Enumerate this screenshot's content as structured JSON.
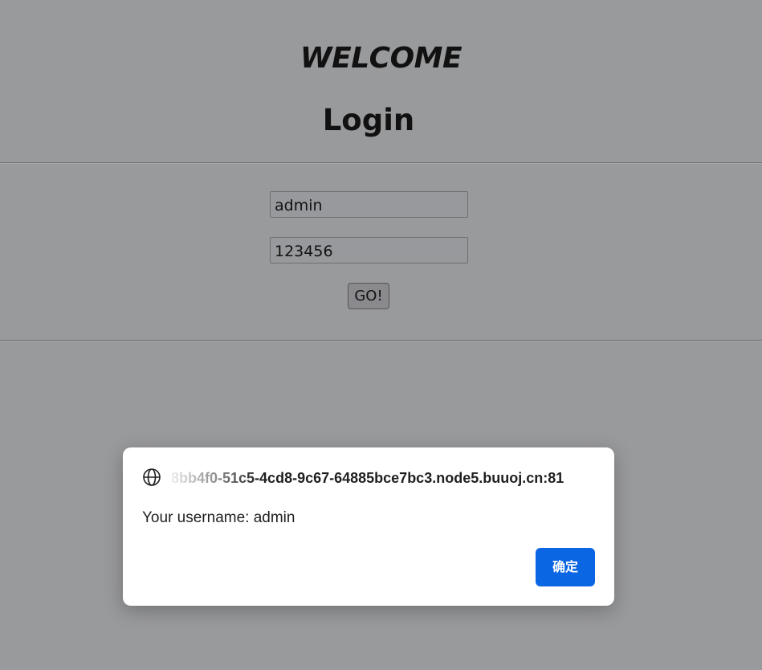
{
  "page": {
    "heading_welcome": "WELCOME",
    "heading_login": "Login"
  },
  "form": {
    "username_value": "admin",
    "password_value": "123456",
    "submit_label": "GO!"
  },
  "dialog": {
    "origin": "8bb4f0-51c5-4cd8-9c67-64885bce7bc3.node5.buuoj.cn:81",
    "origin_icon": "globe-icon",
    "message": "Your username: admin",
    "ok_label": "确定",
    "ok_color": "#0b66e4"
  },
  "colors": {
    "overlay_background": "#999a9c",
    "dialog_background": "#ffffff"
  }
}
